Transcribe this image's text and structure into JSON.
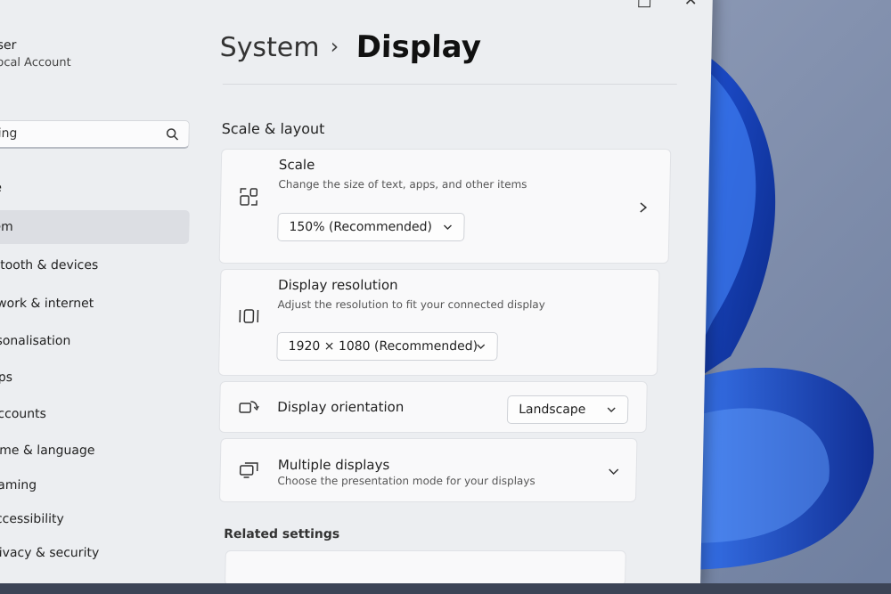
{
  "window": {
    "minimize_glyph": "□",
    "close_glyph": "✕"
  },
  "user": {
    "name": "ser",
    "account_type": "ocal Account"
  },
  "search": {
    "value": "ing",
    "icon": "search-icon"
  },
  "nav": [
    {
      "label": "e",
      "active": false
    },
    {
      "label": "em",
      "active": true
    },
    {
      "label": "etooth & devices",
      "active": false
    },
    {
      "label": "twork & internet",
      "active": false
    },
    {
      "label": "rsonalisation",
      "active": false
    },
    {
      "label": "pps",
      "active": false
    },
    {
      "label": "Accounts",
      "active": false
    },
    {
      "label": "Time & language",
      "active": false
    },
    {
      "label": "Gaming",
      "active": false
    },
    {
      "label": "Accessibility",
      "active": false
    },
    {
      "label": "Privacy & security",
      "active": false
    }
  ],
  "breadcrumb": {
    "parent": "System",
    "separator": "›",
    "current": "Display"
  },
  "sections": {
    "scale_layout": "Scale & layout",
    "related": "Related settings"
  },
  "scale": {
    "title": "Scale",
    "description": "Change the size of text, apps, and other items",
    "value": "150% (Recommended)"
  },
  "resolution": {
    "title": "Display resolution",
    "description": "Adjust the resolution to fit your connected display",
    "value": "1920 × 1080 (Recommended)"
  },
  "orientation": {
    "title": "Display orientation",
    "value": "Landscape"
  },
  "multiple": {
    "title": "Multiple displays",
    "description": "Choose the presentation mode for your displays"
  },
  "colors": {
    "accent": "#1a56d6",
    "window_bg": "#eceef1",
    "card_bg": "#f9f9fa"
  }
}
